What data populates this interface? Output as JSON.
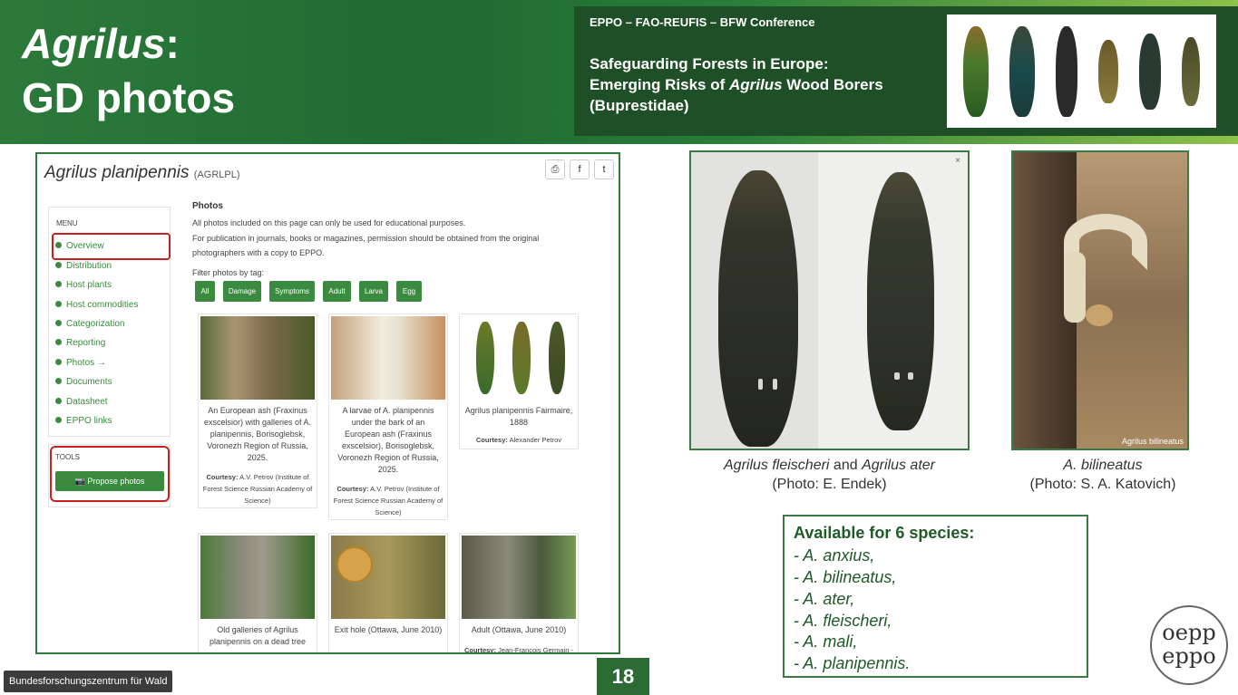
{
  "slide": {
    "title_genus": "Agrilus",
    "title_colon": ":",
    "title_line2": "GD photos",
    "conference_name": "EPPO – FAO-REUFIS – BFW Conference",
    "conference_title_l1": "Safeguarding Forests in Europe:",
    "conference_title_l2_pre": "Emerging Risks of ",
    "conference_title_l2_em": "Agrilus",
    "conference_title_l2_post": " Wood Borers",
    "conference_title_l3": "(Buprestidae)",
    "page_number": "18",
    "org_label": "Bundesforschungszentrum für Wald",
    "logo_line1": "oepp",
    "logo_line2": "eppo"
  },
  "gd": {
    "species_title": "Agrilus planipennis",
    "species_code": "(AGRLPL)",
    "share_icons": [
      "print-icon",
      "facebook-icon",
      "twitter-icon"
    ],
    "share_glyphs": [
      "⎙",
      "f",
      "t"
    ],
    "menu_label": "MENU",
    "menu_items": [
      "Overview",
      "Distribution",
      "Host plants",
      "Host commodities",
      "Categorization",
      "Reporting",
      "Photos →",
      "Documents",
      "Datasheet",
      "EPPO links"
    ],
    "tools_label": "TOOLS",
    "propose_button": "Propose photos",
    "photos_heading": "Photos",
    "photos_text_1": "All photos included on this page can only be used for educational purposes.",
    "photos_text_2": "For publication in journals, books or magazines, permission should be obtained from the original",
    "photos_text_3": "photographers with a copy to EPPO.",
    "filter_label": "Filter photos by tag:",
    "tags": [
      "All",
      "Damage",
      "Symptoms",
      "Adult",
      "Larva",
      "Egg"
    ],
    "cards": [
      {
        "caption": "An European ash (Fraxinus exscelsior) with galleries of A. planipennis, Borisoglebsk, Voronezh Region of Russia, 2025.",
        "courtesy_label": "Courtesy:",
        "courtesy": "A.V. Petrov (Institute of Forest Science Russian Academy of Science)"
      },
      {
        "caption": "A larvae of A. planipennis under the bark of an European ash (Fraxinus exscelsior), Borisoglebsk, Voronezh Region of Russia, 2025.",
        "courtesy_label": "Courtesy:",
        "courtesy": "A.V. Petrov (Institute of Forest Science Russian Academy of Science)"
      },
      {
        "caption": "Agrilus planipennis Fairmaire, 1888",
        "courtesy_label": "Courtesy:",
        "courtesy": "Alexander Petrov"
      },
      {
        "caption": "Old galleries of Agrilus planipennis on a dead tree",
        "courtesy_label": "",
        "courtesy": ""
      },
      {
        "caption": "Exit hole (Ottawa, June 2010)",
        "courtesy_label": "",
        "courtesy": ""
      },
      {
        "caption": "Adult (Ottawa, June 2010)",
        "courtesy_label": "Courtesy:",
        "courtesy": "Jean-François Germain -"
      }
    ]
  },
  "photo1": {
    "caption_em1": "Agrilus fleischeri",
    "caption_and": " and ",
    "caption_em2": "Agrilus ater",
    "credit": "(Photo: E. Endek)"
  },
  "photo2": {
    "watermark": "Agrilus bilineatus",
    "caption_em": "A. bilineatus",
    "credit": "(Photo: S. A. Katovich)"
  },
  "available": {
    "heading": "Available for 6 species:",
    "items": [
      "- A. anxius,",
      "- A. bilineatus,",
      "- A. ater,",
      "- A. fleischeri,",
      "- A. mali,",
      "- A. planipennis."
    ]
  },
  "colors": {
    "header_green": "#1f6a32",
    "accent_green": "#3a8a3f",
    "highlight_red": "#c82020",
    "conf_box": "#1f4f26"
  }
}
